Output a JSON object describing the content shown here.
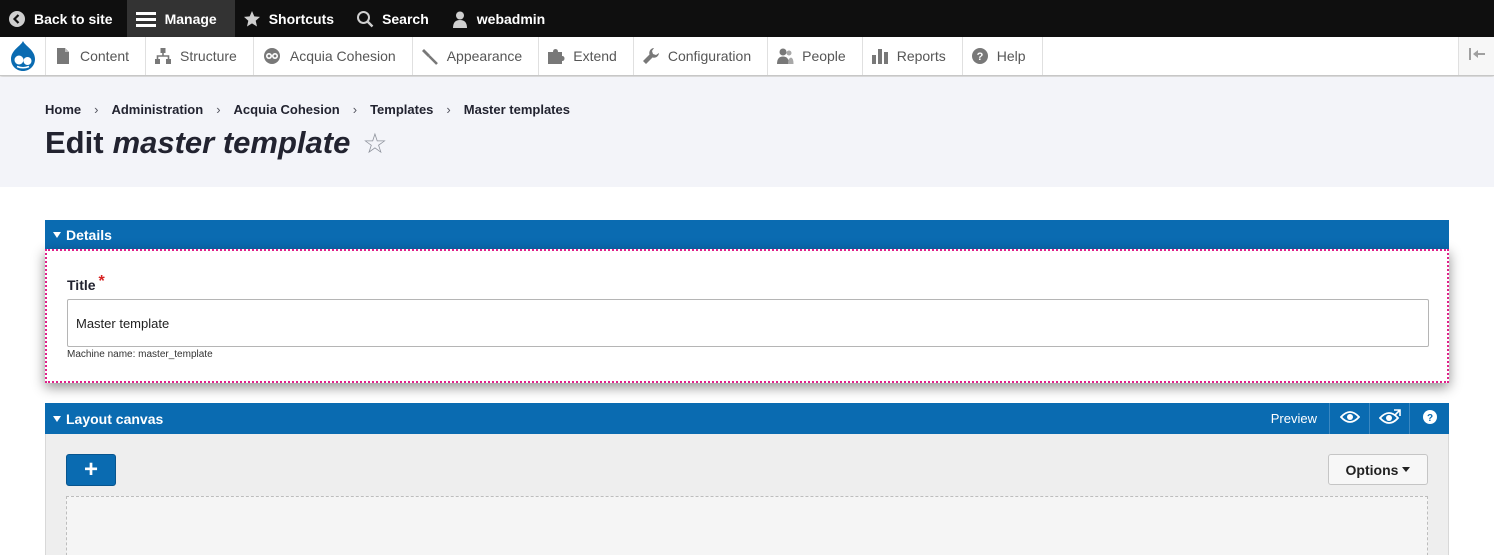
{
  "topbar": {
    "back_label": "Back to site",
    "manage_label": "Manage",
    "shortcuts_label": "Shortcuts",
    "search_label": "Search",
    "user_label": "webadmin"
  },
  "tray": {
    "items": [
      {
        "label": "Content",
        "icon": "file-icon"
      },
      {
        "label": "Structure",
        "icon": "sitemap-icon"
      },
      {
        "label": "Acquia Cohesion",
        "icon": "cohesion-icon"
      },
      {
        "label": "Appearance",
        "icon": "paintbrush-icon"
      },
      {
        "label": "Extend",
        "icon": "puzzle-icon"
      },
      {
        "label": "Configuration",
        "icon": "wrench-icon"
      },
      {
        "label": "People",
        "icon": "people-icon"
      },
      {
        "label": "Reports",
        "icon": "bar-chart-icon"
      },
      {
        "label": "Help",
        "icon": "help-icon"
      }
    ]
  },
  "breadcrumb": [
    "Home",
    "Administration",
    "Acquia Cohesion",
    "Templates",
    "Master templates"
  ],
  "page_title": {
    "prefix": "Edit",
    "emphasis": "master template",
    "star": "☆"
  },
  "details": {
    "heading": "Details",
    "title_label": "Title",
    "required_mark": "*",
    "title_value": "Master template",
    "machine_name": "Machine name: master_template"
  },
  "layout_canvas": {
    "heading": "Layout canvas",
    "preview_label": "Preview",
    "add_label": "+",
    "options_label": "Options"
  },
  "colors": {
    "panel_blue": "#0a6bb1",
    "topbar": "#0f0f0f",
    "header_bg": "#f3f4f9",
    "focus_outline": "#e0218a"
  }
}
